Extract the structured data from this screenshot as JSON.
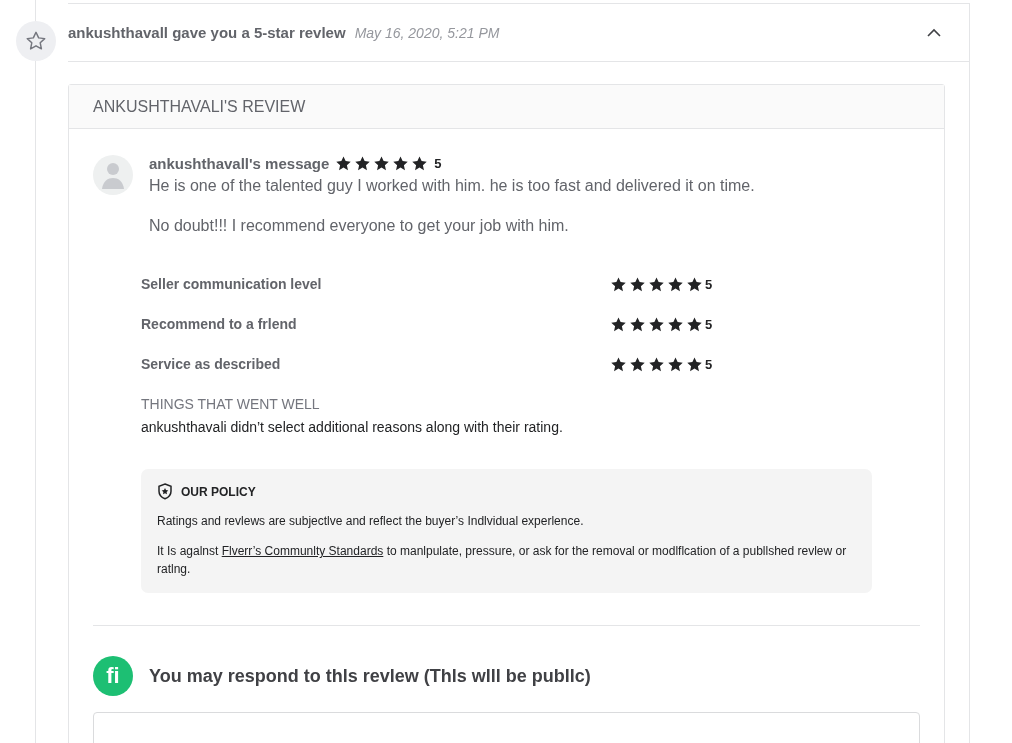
{
  "event": {
    "title": "ankushthavall gave you a 5-star revlew",
    "time": "May 16, 2020, 5:21 PM",
    "expanded": true
  },
  "review": {
    "heading": "ANKUSHTHAVALI'S REVIEW",
    "message": {
      "author": "ankushthavall's message",
      "stars": 5,
      "score": "5",
      "lines": [
        "He is one of the talented guy I worked with him. he is too fast and delivered it on time.",
        "No doubt!!! I recommend everyone to get your job with him."
      ]
    },
    "ratings": [
      {
        "label": "Seller communication level",
        "stars": 5,
        "score": "5"
      },
      {
        "label": "Recommend to a frlend",
        "stars": 5,
        "score": "5"
      },
      {
        "label": "Service as described",
        "stars": 5,
        "score": "5"
      }
    ],
    "went_well": {
      "heading": "THINGS THAT WENT WELL",
      "text": "ankushthavali didn’t select additional reasons along with their rating."
    },
    "policy": {
      "title": "OUR POLICY",
      "text": "Ratings and revlews are subjectlve and reflect the buyer’s Indlvidual experlence.",
      "pre": "It Is agalnst",
      "link": "Flverr’s Communlty Standards",
      "post": "to manlpulate, pressure, or ask for the removal or modlflcation of a publlshed revlew or ratlng."
    }
  },
  "response": {
    "logo": "fi",
    "title": "You may respond to thls revlew (Thls wlll be publlc)"
  }
}
